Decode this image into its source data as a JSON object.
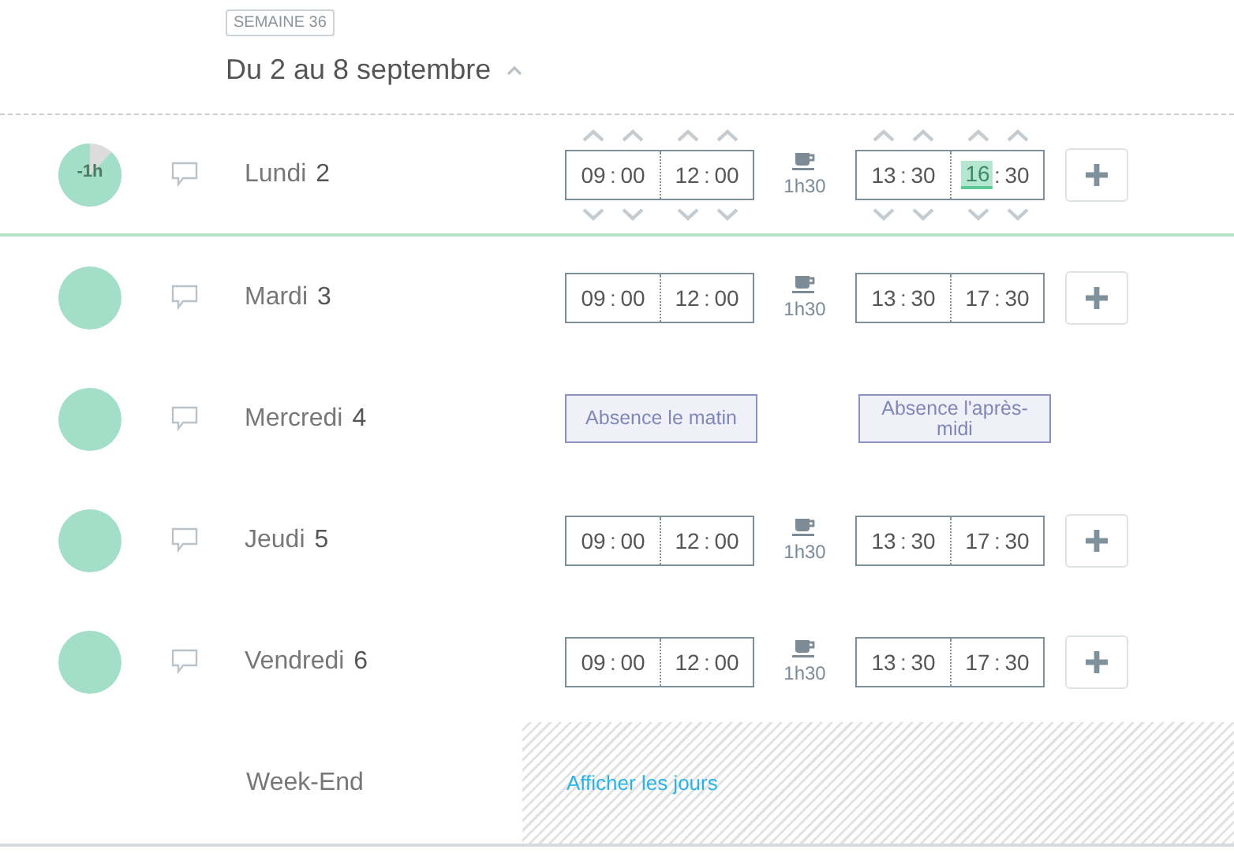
{
  "header": {
    "week_badge": "SEMAINE 36",
    "title": "Du 2 au 8 septembre",
    "collapsed": false
  },
  "time_separator": ":",
  "days": [
    {
      "kind": "hours",
      "name": "Lundi",
      "number": "2",
      "expanded": true,
      "balance": "-1h",
      "morning": {
        "start": {
          "hours": "09",
          "minutes": "00",
          "selected": false
        },
        "end": {
          "hours": "12",
          "minutes": "00",
          "selected": false
        }
      },
      "pause": "1h30",
      "afternoon": {
        "start": {
          "hours": "13",
          "minutes": "30",
          "selected": false
        },
        "end": {
          "hours": "16",
          "minutes": "30",
          "selected": true
        }
      }
    },
    {
      "kind": "hours",
      "name": "Mardi",
      "number": "3",
      "expanded": false,
      "morning": {
        "start": {
          "hours": "09",
          "minutes": "00",
          "selected": false
        },
        "end": {
          "hours": "12",
          "minutes": "00",
          "selected": false
        }
      },
      "pause": "1h30",
      "afternoon": {
        "start": {
          "hours": "13",
          "minutes": "30",
          "selected": false
        },
        "end": {
          "hours": "17",
          "minutes": "30",
          "selected": false
        }
      }
    },
    {
      "kind": "absence",
      "name": "Mercredi",
      "number": "4",
      "expanded": false,
      "absences": [
        "Absence le matin",
        "Absence l'après-midi"
      ]
    },
    {
      "kind": "hours",
      "name": "Jeudi",
      "number": "5",
      "expanded": false,
      "morning": {
        "start": {
          "hours": "09",
          "minutes": "00",
          "selected": false
        },
        "end": {
          "hours": "12",
          "minutes": "00",
          "selected": false
        }
      },
      "pause": "1h30",
      "afternoon": {
        "start": {
          "hours": "13",
          "minutes": "30",
          "selected": false
        },
        "end": {
          "hours": "17",
          "minutes": "30",
          "selected": false
        }
      }
    },
    {
      "kind": "hours",
      "name": "Vendredi",
      "number": "6",
      "expanded": false,
      "morning": {
        "start": {
          "hours": "09",
          "minutes": "00",
          "selected": false
        },
        "end": {
          "hours": "12",
          "minutes": "00",
          "selected": false
        }
      },
      "pause": "1h30",
      "afternoon": {
        "start": {
          "hours": "13",
          "minutes": "30",
          "selected": false
        },
        "end": {
          "hours": "17",
          "minutes": "30",
          "selected": false
        }
      }
    }
  ],
  "weekend": {
    "label": "Week-End",
    "link": "Afficher les jours"
  }
}
